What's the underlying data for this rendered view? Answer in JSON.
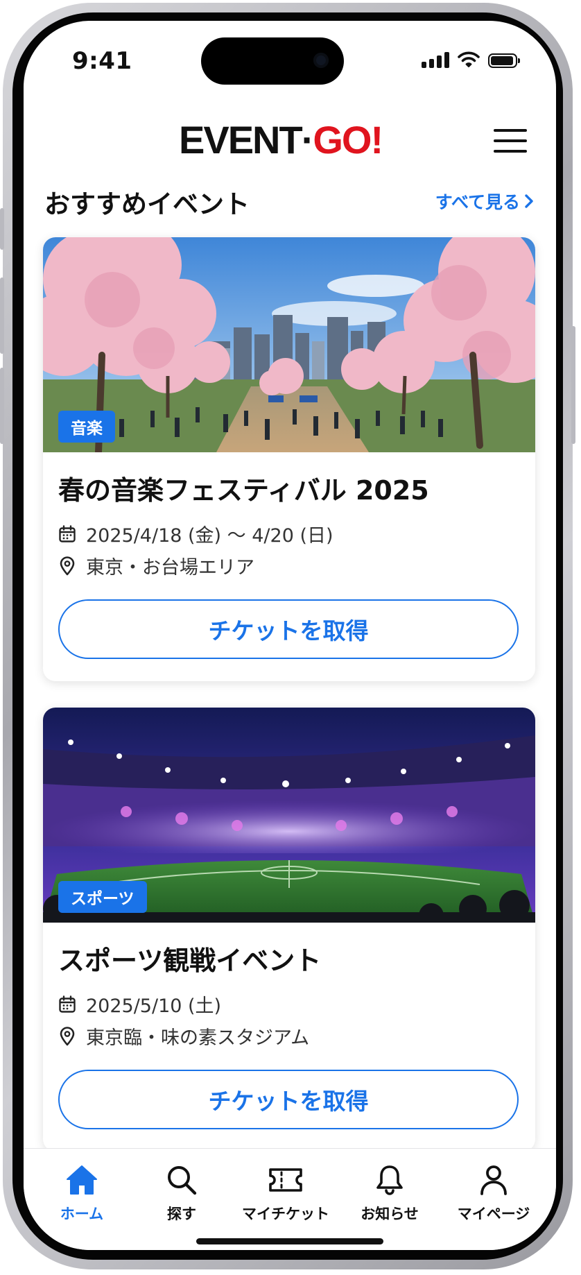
{
  "status_bar": {
    "time": "9:41"
  },
  "header": {
    "logo_part1": "EVENT",
    "logo_dot": "·",
    "logo_part2": "GO!"
  },
  "section": {
    "title": "おすすめイベント",
    "see_all": "すべて見る"
  },
  "events": [
    {
      "tag": "音楽",
      "title": "春の音楽フェスティバル 2025",
      "date": "2025/4/18 (金) 〜 4/20 (日)",
      "location": "東京・お台場エリア",
      "button": "チケットを取得"
    },
    {
      "tag": "スポーツ",
      "title": "スポーツ観戦イベント",
      "date": "2025/5/10 (土)",
      "location": "東京臨・味の素スタジアム",
      "button": "チケットを取得"
    }
  ],
  "tab_bar": {
    "items": [
      {
        "label": "ホーム",
        "icon": "home-icon",
        "active": true
      },
      {
        "label": "探す",
        "icon": "search-icon",
        "active": false
      },
      {
        "label": "マイチケット",
        "icon": "ticket-icon",
        "active": false
      },
      {
        "label": "お知らせ",
        "icon": "bell-icon",
        "active": false
      },
      {
        "label": "マイページ",
        "icon": "person-icon",
        "active": false
      }
    ]
  },
  "colors": {
    "accent": "#1a73e8",
    "brand_red": "#e0141e",
    "text": "#111111"
  }
}
